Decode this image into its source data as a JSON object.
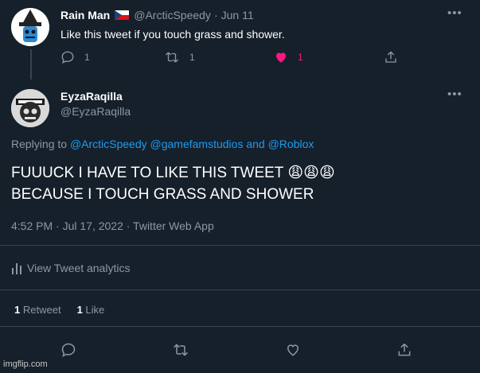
{
  "parent_tweet": {
    "display_name": "Rain Man",
    "flag": "🇨🇿",
    "handle": "@ArcticSpeedy",
    "sep": "·",
    "date": "Jun 11",
    "text": "Like this tweet if you touch grass and shower.",
    "actions": {
      "reply_count": "1",
      "retweet_count": "1",
      "like_count": "1"
    }
  },
  "main_tweet": {
    "display_name": "EyzaRaqilla",
    "handle": "@EyzaRaqilla",
    "replying_prefix": "Replying to",
    "replying_to": "@ArcticSpeedy @gamefamstudios",
    "replying_and": "and",
    "replying_last": "@Roblox",
    "text_line1": "FUUUCK I HAVE TO LIKE THIS TWEET 😩😩😩",
    "text_line2": "BECAUSE I TOUCH GRASS AND SHOWER",
    "timestamp": "4:52 PM · Jul 17, 2022 · Twitter Web App",
    "analytics_label": "View Tweet analytics",
    "retweets_count": "1",
    "retweets_label": "Retweet",
    "likes_count": "1",
    "likes_label": "Like"
  },
  "watermark": "imgflip.com",
  "colors": {
    "background": "#15202b",
    "accent": "#1d9bf0",
    "like": "#f91880",
    "muted": "#8b98a5",
    "divider": "#38444d"
  }
}
